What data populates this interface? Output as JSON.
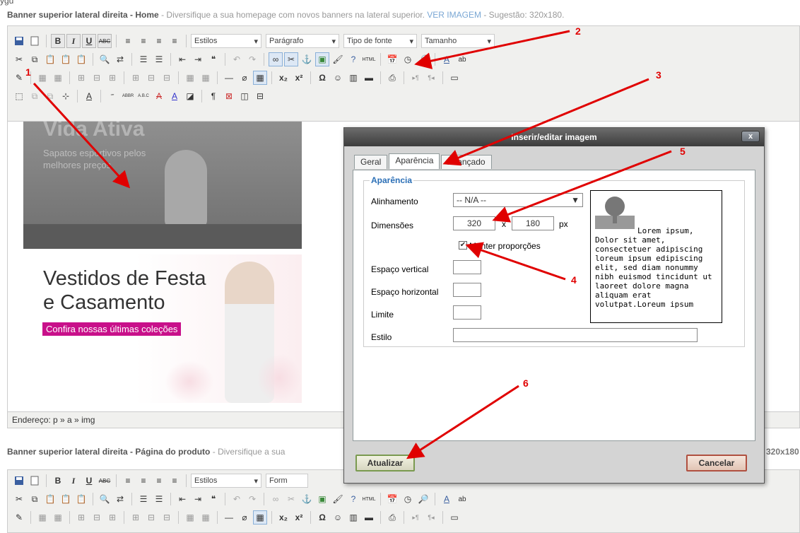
{
  "corner_text": "ÿgu",
  "section1": {
    "title": "Banner superior lateral direita - Home",
    "dash": " - ",
    "desc": "Diversifique a sua homepage com novos banners na lateral superior.",
    "link": "VER IMAGEM",
    "hint": " - Sugestão: 320x180."
  },
  "section2": {
    "title": "Banner superior lateral direita - Página do produto",
    "dash": " - ",
    "desc": "Diversifique a sua",
    "right_fragment": "320x180"
  },
  "toolbar": {
    "styles": "Estilos",
    "format": "Parágrafo",
    "font": "Tipo de fonte",
    "size": "Tamanho",
    "format2": "Form"
  },
  "content": {
    "banner1_title": "Vida Ativa",
    "banner1_sub": "Sapatos esportivos pelos melhores preços",
    "banner2_line1": "Vestidos de Festa",
    "banner2_line2": "e Casamento",
    "banner2_cta": "Confira nossas últimas coleções"
  },
  "status_path": "Endereço: p » a » img",
  "dialog": {
    "title": "Inserir/editar imagem",
    "close": "x",
    "tabs": [
      "Geral",
      "Aparência",
      "Avançado"
    ],
    "legend": "Aparência",
    "align_label": "Alinhamento",
    "align_value": "-- N/A --",
    "dim_label": "Dimensões",
    "width": "320",
    "x": "x",
    "height": "180",
    "unit": "px",
    "keep_label": "Manter proporções",
    "vspace_label": "Espaço vertical",
    "hspace_label": "Espaço horizontal",
    "border_label": "Limite",
    "style_label": "Estilo",
    "preview_text": "Lorem ipsum, Dolor sit amet, consectetuer adipiscing loreum ipsum edipiscing elit, sed diam nonummy nibh euismod tincidunt ut laoreet dolore magna aliquam erat volutpat.Loreum ipsum",
    "update": "Atualizar",
    "cancel": "Cancelar"
  },
  "annotations": [
    "1",
    "2",
    "3",
    "4",
    "5",
    "6"
  ],
  "colors": {
    "annotation": "#e00000",
    "dialog_title": "#4a4a4a",
    "cta_bg": "#c8108a",
    "legend": "#2b6fb6"
  }
}
